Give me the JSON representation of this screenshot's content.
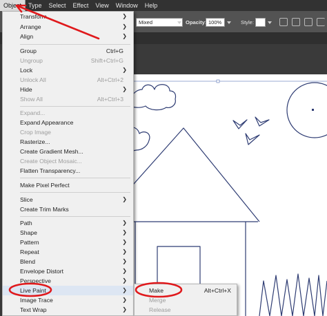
{
  "menubar": {
    "items": [
      {
        "label": "Object",
        "active": true
      },
      {
        "label": "Type"
      },
      {
        "label": "Select"
      },
      {
        "label": "Effect"
      },
      {
        "label": "View"
      },
      {
        "label": "Window"
      },
      {
        "label": "Help"
      }
    ]
  },
  "controlbar": {
    "blend_mode": "Mixed",
    "opacity_label": "Opacity:",
    "opacity_value": "100%",
    "style_label": "Style:"
  },
  "object_menu": {
    "items": [
      {
        "label": "Transform",
        "shortcut": "",
        "submenu": true,
        "disabled": false
      },
      {
        "label": "Arrange",
        "shortcut": "",
        "submenu": true,
        "disabled": false
      },
      {
        "label": "Align",
        "shortcut": "",
        "submenu": true,
        "disabled": false
      },
      {
        "label": "Group",
        "shortcut": "Ctrl+G",
        "submenu": false,
        "disabled": false
      },
      {
        "label": "Ungroup",
        "shortcut": "Shift+Ctrl+G",
        "submenu": false,
        "disabled": true
      },
      {
        "label": "Lock",
        "shortcut": "",
        "submenu": true,
        "disabled": false
      },
      {
        "label": "Unlock All",
        "shortcut": "Alt+Ctrl+2",
        "submenu": false,
        "disabled": true
      },
      {
        "label": "Hide",
        "shortcut": "",
        "submenu": true,
        "disabled": false
      },
      {
        "label": "Show All",
        "shortcut": "Alt+Ctrl+3",
        "submenu": false,
        "disabled": true
      },
      {
        "label": "Expand...",
        "shortcut": "",
        "submenu": false,
        "disabled": true
      },
      {
        "label": "Expand Appearance",
        "shortcut": "",
        "submenu": false,
        "disabled": false
      },
      {
        "label": "Crop Image",
        "shortcut": "",
        "submenu": false,
        "disabled": true
      },
      {
        "label": "Rasterize...",
        "shortcut": "",
        "submenu": false,
        "disabled": false
      },
      {
        "label": "Create Gradient Mesh...",
        "shortcut": "",
        "submenu": false,
        "disabled": false
      },
      {
        "label": "Create Object Mosaic...",
        "shortcut": "",
        "submenu": false,
        "disabled": true
      },
      {
        "label": "Flatten Transparency...",
        "shortcut": "",
        "submenu": false,
        "disabled": false
      },
      {
        "label": "Make Pixel Perfect",
        "shortcut": "",
        "submenu": false,
        "disabled": false
      },
      {
        "label": "Slice",
        "shortcut": "",
        "submenu": true,
        "disabled": false
      },
      {
        "label": "Create Trim Marks",
        "shortcut": "",
        "submenu": false,
        "disabled": false
      },
      {
        "label": "Path",
        "shortcut": "",
        "submenu": true,
        "disabled": false
      },
      {
        "label": "Shape",
        "shortcut": "",
        "submenu": true,
        "disabled": false
      },
      {
        "label": "Pattern",
        "shortcut": "",
        "submenu": true,
        "disabled": false
      },
      {
        "label": "Repeat",
        "shortcut": "",
        "submenu": true,
        "disabled": false
      },
      {
        "label": "Blend",
        "shortcut": "",
        "submenu": true,
        "disabled": false
      },
      {
        "label": "Envelope Distort",
        "shortcut": "",
        "submenu": true,
        "disabled": false
      },
      {
        "label": "Perspective",
        "shortcut": "",
        "submenu": true,
        "disabled": false
      },
      {
        "label": "Live Paint",
        "shortcut": "",
        "submenu": true,
        "disabled": false,
        "highlighted": true
      },
      {
        "label": "Image Trace",
        "shortcut": "",
        "submenu": true,
        "disabled": false
      },
      {
        "label": "Text Wrap",
        "shortcut": "",
        "submenu": true,
        "disabled": false
      }
    ]
  },
  "live_paint_submenu": {
    "items": [
      {
        "label": "Make",
        "shortcut": "Alt+Ctrl+X",
        "disabled": false
      },
      {
        "label": "Merge",
        "shortcut": "",
        "disabled": true
      },
      {
        "label": "Release",
        "shortcut": "",
        "disabled": true
      }
    ]
  },
  "icons": {
    "submenu_arrow": "chevron-right-icon",
    "search": "search-icon",
    "settings": "gear-icon"
  },
  "colors": {
    "annotation": "#e0191c",
    "artwork_stroke": "#2e3c73",
    "menu_bg": "#f0f0f0",
    "menu_highlight": "#dde6f3",
    "disabled_text": "#9d9d9d"
  }
}
